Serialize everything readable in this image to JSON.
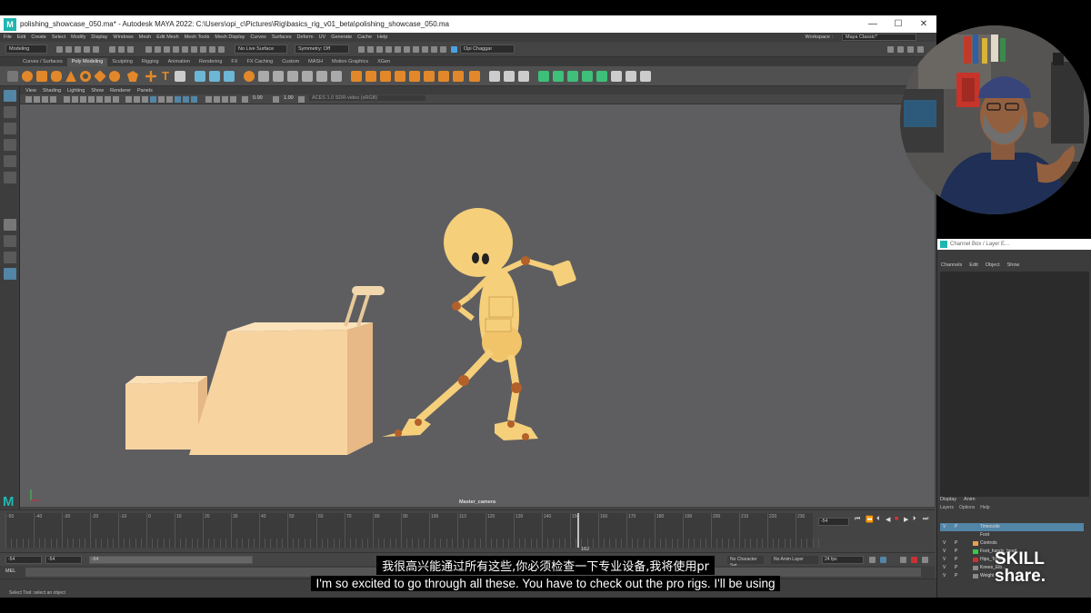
{
  "window": {
    "title": "polishing_showcase_050.ma* - Autodesk MAYA 2022: C:\\Users\\opi_c\\Pictures\\Rig\\basics_rig_v01_beta\\polishing_showcase_050.ma",
    "logo": "M",
    "minimize": "—",
    "maximize": "☐",
    "close": "✕"
  },
  "menu": {
    "items": [
      "File",
      "Edit",
      "Create",
      "Select",
      "Modify",
      "Display",
      "Windows",
      "Mesh",
      "Edit Mesh",
      "Mesh Tools",
      "Mesh Display",
      "Curves",
      "Surfaces",
      "Deform",
      "UV",
      "Generate",
      "Cache",
      "Help"
    ],
    "workspace_label": "Workspace :",
    "workspace_value": "Maya Classic*"
  },
  "status": {
    "mode": "Modeling",
    "live_surface": "No Live Surface",
    "symmetry": "Symmetry: Off",
    "user": "Opi Chaggar"
  },
  "shelf_tabs": [
    "Curves / Surfaces",
    "Poly Modeling",
    "Sculpting",
    "Rigging",
    "Animation",
    "Rendering",
    "FX",
    "FX Caching",
    "Custom",
    "MASH",
    "Motion Graphics",
    "XGen"
  ],
  "shelf_active": "Poly Modeling",
  "panel_menu": [
    "View",
    "Shading",
    "Lighting",
    "Show",
    "Renderer",
    "Panels"
  ],
  "panel_values": {
    "field1": "0.00",
    "field2": "1.00",
    "colorspace": "ACES 1.0 SDR-video (sRGB)"
  },
  "viewport": {
    "camera": "Master_camera",
    "colors": {
      "background": "#5e5e61",
      "character": "#f5cf7a",
      "joint": "#b3602a",
      "props": "#f7d3a0"
    }
  },
  "timeline": {
    "ticks": [
      "-50",
      "-40",
      "-30",
      "-20",
      "-10",
      "0",
      "10",
      "20",
      "30",
      "40",
      "50",
      "60",
      "70",
      "80",
      "90",
      "100",
      "110",
      "120",
      "130",
      "140",
      "150",
      "160",
      "170",
      "180",
      "190",
      "200",
      "210",
      "220",
      "230"
    ],
    "current_frame_label": "162",
    "current_field": "-54"
  },
  "range": {
    "start": "-54",
    "start2": "-54",
    "inner_start": "-54",
    "char_set": "No Character Set",
    "anim_layer": "No Anim Layer",
    "fps": "24 fps"
  },
  "cmd": {
    "mel": "MEL"
  },
  "help_line": "Select Tool: select an object",
  "channel_box": {
    "title": "Channel Box / Layer E...",
    "menu": [
      "Channels",
      "Edit",
      "Object",
      "Show"
    ],
    "layer_tabs": [
      "Display",
      "Anim"
    ],
    "layer_menu": [
      "Layers",
      "Options",
      "Help"
    ],
    "layers": [
      {
        "v": "V",
        "p": "P",
        "name": "Timecode",
        "color": "#5285a6",
        "selected": true
      },
      {
        "v": "",
        "p": "",
        "name": "Foot",
        "color": "",
        "selected": false
      },
      {
        "v": "V",
        "p": "P",
        "name": "Controls",
        "color": "#e8a24a",
        "selected": false
      },
      {
        "v": "V",
        "p": "P",
        "name": "Foot_hands_head",
        "color": "#39c84a",
        "selected": false
      },
      {
        "v": "V",
        "p": "P",
        "name": "Hips_Torso",
        "color": "#c83232",
        "selected": false
      },
      {
        "v": "V",
        "p": "P",
        "name": "Knees_Elb...",
        "color": "#8a8a8a",
        "selected": false
      },
      {
        "v": "V",
        "p": "P",
        "name": "Weight",
        "color": "#8a8a8a",
        "selected": false
      }
    ]
  },
  "subtitles": {
    "zh": "我很高兴能通过所有这些,你必须检查一下专业设备,我将使用pr",
    "en": "I'm so excited to go through all these. You have to check out the pro rigs. I'll be using"
  },
  "brand": {
    "line1": "SKILL",
    "line2": "share."
  }
}
